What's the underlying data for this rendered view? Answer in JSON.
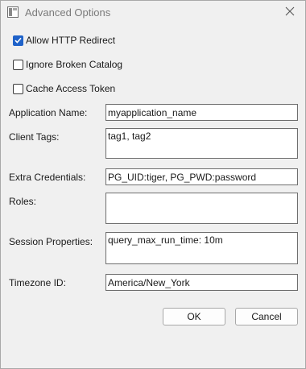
{
  "window": {
    "title": "Advanced Options",
    "icons": {
      "app": "app-window-icon",
      "close": "close-icon"
    }
  },
  "options": [
    {
      "label": "Allow HTTP Redirect",
      "checked": true
    },
    {
      "label": "Ignore Broken Catalog",
      "checked": false
    },
    {
      "label": "Cache Access Token",
      "checked": false
    }
  ],
  "fields": {
    "application_name": {
      "label": "Application Name:",
      "value": "myapplication_name"
    },
    "client_tags": {
      "label": "Client Tags:",
      "value": "tag1, tag2"
    },
    "extra_credentials": {
      "label": "Extra Credentials:",
      "value": "PG_UID:tiger, PG_PWD:password"
    },
    "roles": {
      "label": "Roles:",
      "value": ""
    },
    "session_properties": {
      "label": "Session Properties:",
      "value": "query_max_run_time: 10m"
    },
    "timezone_id": {
      "label": "Timezone ID:",
      "value": "America/New_York"
    }
  },
  "buttons": {
    "ok": "OK",
    "cancel": "Cancel"
  },
  "colors": {
    "accent": "#1f62c9",
    "background": "#f0f0f0"
  }
}
